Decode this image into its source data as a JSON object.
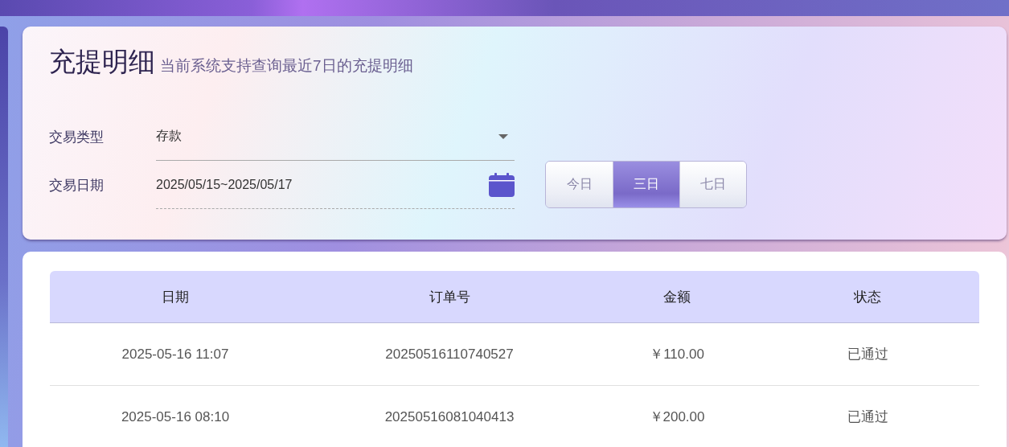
{
  "header": {
    "title": "充提明细",
    "subtitle": "当前系统支持查询最近7日的充提明细"
  },
  "filters": {
    "type_label": "交易类型",
    "type_value": "存款",
    "date_label": "交易日期",
    "date_value": "2025/05/15~2025/05/17"
  },
  "range_buttons": [
    {
      "label": "今日",
      "selected": false
    },
    {
      "label": "三日",
      "selected": true
    },
    {
      "label": "七日",
      "selected": false
    }
  ],
  "table": {
    "columns": [
      "日期",
      "订单号",
      "金额",
      "状态"
    ],
    "rows": [
      [
        "2025-05-16 11:07",
        "20250516110740527",
        "￥110.00",
        "已通过"
      ],
      [
        "2025-05-16 08:10",
        "20250516081040413",
        "￥200.00",
        "已通过"
      ]
    ]
  }
}
